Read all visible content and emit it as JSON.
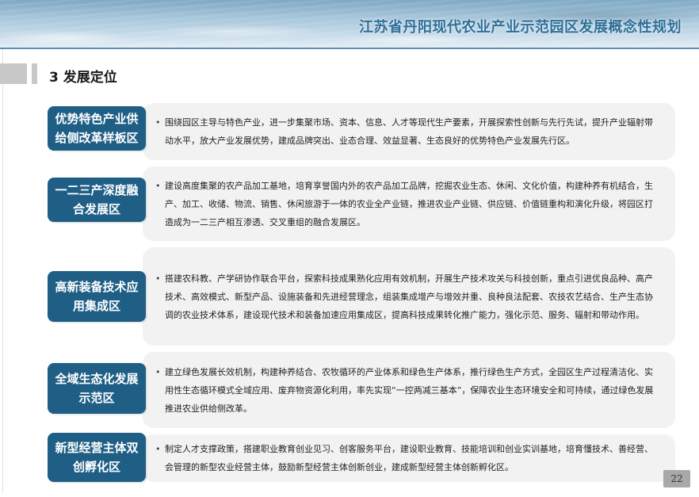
{
  "header": {
    "title": "江苏省丹阳现代农业产业示范园区发展概念性规划"
  },
  "section": {
    "title": "3  发展定位"
  },
  "rows": [
    {
      "label": "优势特色产业供给侧改革样板区",
      "text": "围绕园区主导与特色产业，进一步集聚市场、资本、信息、人才等现代生产要素，开展探索性创新与先行先试，提升产业辐射带动水平，放大产业发展优势，建成品牌突出、业态合理、效益显著、生态良好的优势特色产业发展先行区。"
    },
    {
      "label": "一二三产深度融合发展区",
      "text": "建设高度集聚的农产品加工基地，培育享誉国内外的农产品加工品牌，挖掘农业生态、休闲、文化价值，构建种养有机结合，生产、加工、收储、物流、销售、休闲旅游于一体的农业全产业链，推进农业产业链、供应链、价值链重构和演化升级，将园区打造成为一二三产相互渗透、交叉重组的融合发展区。"
    },
    {
      "label": "高新装备技术应用集成区",
      "text": "搭建农科教、产学研协作联合平台，探索科技成果熟化应用有效机制，开展生产技术攻关与科技创新，重点引进优良品种、高产技术、高效模式、新型产品、设施装备和先进经营理念，组装集成增产与增效并重、良种良法配套、农技农艺结合、生产生态协调的农业技术体系，建设现代技术和装备加速应用集成区，提高科技成果转化推广能力，强化示范、服务、辐射和带动作用。"
    },
    {
      "label": "全域生态化发展示范区",
      "text": "建立绿色发展长效机制，构建种养结合、农牧循环的产业体系和绿色生产体系，推行绿色生产方式，全园区生产过程清洁化、实用性生态循环模式全域应用、废弃物资源化利用，率先实现“一控两减三基本”，保障农业生态环境安全和可持续，通过绿色发展推进农业供给侧改革。"
    },
    {
      "label": "新型经营主体双创孵化区",
      "text": "制定人才支撑政策，搭建职业教育创业见习、创客服务平台，建设职业教育、技能培训和创业实训基地，培育懂技术、善经营、会管理的新型农业经营主体，鼓励新型经营主体创新创业，建成新型经营主体创新孵化区。"
    }
  ],
  "page_number": "22",
  "colors": {
    "label_bg": "#1f5f86",
    "row_bg": "#f2f2f2",
    "title_color": "#2e6f97",
    "page_num_bg": "#a8a8a8"
  }
}
